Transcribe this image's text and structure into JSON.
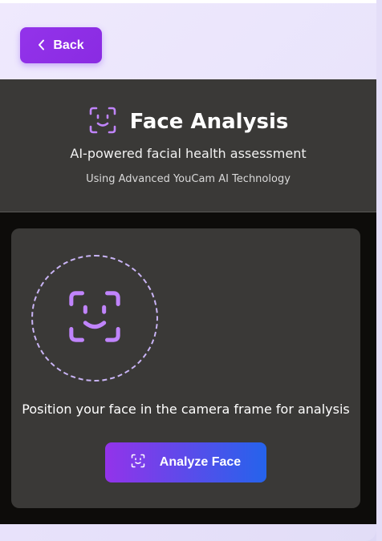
{
  "nav": {
    "back_label": "Back",
    "back_icon": "chevron-left-icon"
  },
  "header": {
    "title": "Face Analysis",
    "title_icon": "face-scan-icon",
    "subtitle": "AI-powered facial health assessment",
    "technology": "Using Advanced YouCam AI Technology"
  },
  "capture": {
    "icon": "face-scan-icon",
    "instruction": "Position your face in the camera frame for analysis",
    "analyze_label": "Analyze Face",
    "analyze_icon": "face-scan-icon"
  },
  "colors": {
    "accent_purple": "#9333ea",
    "accent_blue": "#2563eb",
    "icon_lilac": "#c084fc",
    "panel": "#3a3937"
  }
}
